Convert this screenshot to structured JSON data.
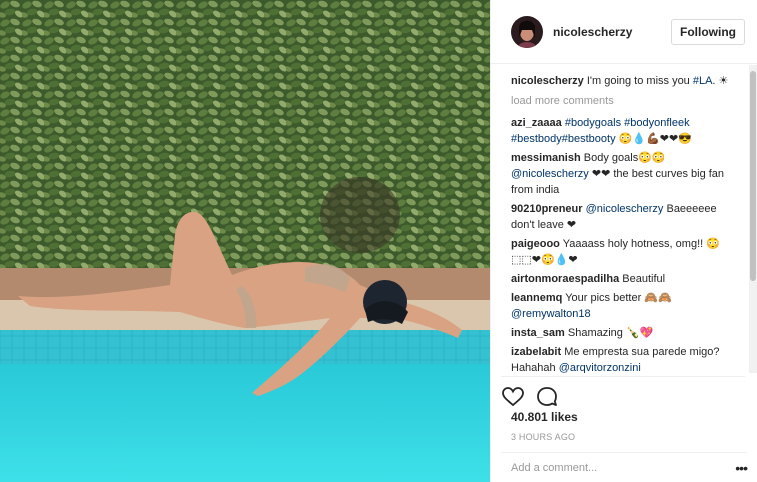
{
  "post": {
    "username": "nicolescherzy",
    "follow_label": "Following",
    "caption": {
      "user": "nicolescherzy",
      "text": "I'm going to miss you ",
      "tag": "#LA.",
      "suffix": " ☀"
    },
    "load_more": "load more comments",
    "comments": [
      {
        "user": "azi_zaaaa",
        "parts": [
          {
            "t": "tag",
            "v": "#bodygoals"
          },
          {
            "t": "text",
            "v": " "
          },
          {
            "t": "tag",
            "v": "#bodyonfleek"
          },
          {
            "t": "text",
            "v": " "
          },
          {
            "t": "tag",
            "v": "#bestbody"
          },
          {
            "t": "tag",
            "v": "#bestbooty"
          },
          {
            "t": "text",
            "v": " 😳💧💪🏾❤❤😎"
          }
        ]
      },
      {
        "user": "messimanish",
        "parts": [
          {
            "t": "text",
            "v": "Body goals😳😳 "
          },
          {
            "t": "tag",
            "v": "@nicolescherzy"
          },
          {
            "t": "text",
            "v": " ❤❤ the best curves big fan from india"
          }
        ]
      },
      {
        "user": "90210preneur",
        "parts": [
          {
            "t": "tag",
            "v": "@nicolescherzy"
          },
          {
            "t": "text",
            "v": " Baeeeeee don't leave ❤"
          }
        ]
      },
      {
        "user": "paigeooo",
        "parts": [
          {
            "t": "text",
            "v": "Yaaaass holy hotness, omg!! 😳 ⬚⬚❤😳💧❤"
          }
        ]
      },
      {
        "user": "airtonmoraespadilha",
        "parts": [
          {
            "t": "text",
            "v": "Beautiful"
          }
        ]
      },
      {
        "user": "leannemq",
        "parts": [
          {
            "t": "text",
            "v": "Your pics better 🙈🙈 "
          },
          {
            "t": "tag",
            "v": "@remywalton18"
          }
        ]
      },
      {
        "user": "insta_sam",
        "parts": [
          {
            "t": "text",
            "v": "Shamazing 🍾💖"
          }
        ]
      },
      {
        "user": "izabelabit",
        "parts": [
          {
            "t": "text",
            "v": "Me empresta sua parede migo? Hahahah "
          },
          {
            "t": "tag",
            "v": "@arqvitorzonzini"
          }
        ]
      }
    ],
    "likes": "40.801 likes",
    "time": "3 HOURS AGO",
    "add_comment_placeholder": "Add a comment...",
    "more_options": "•••"
  }
}
